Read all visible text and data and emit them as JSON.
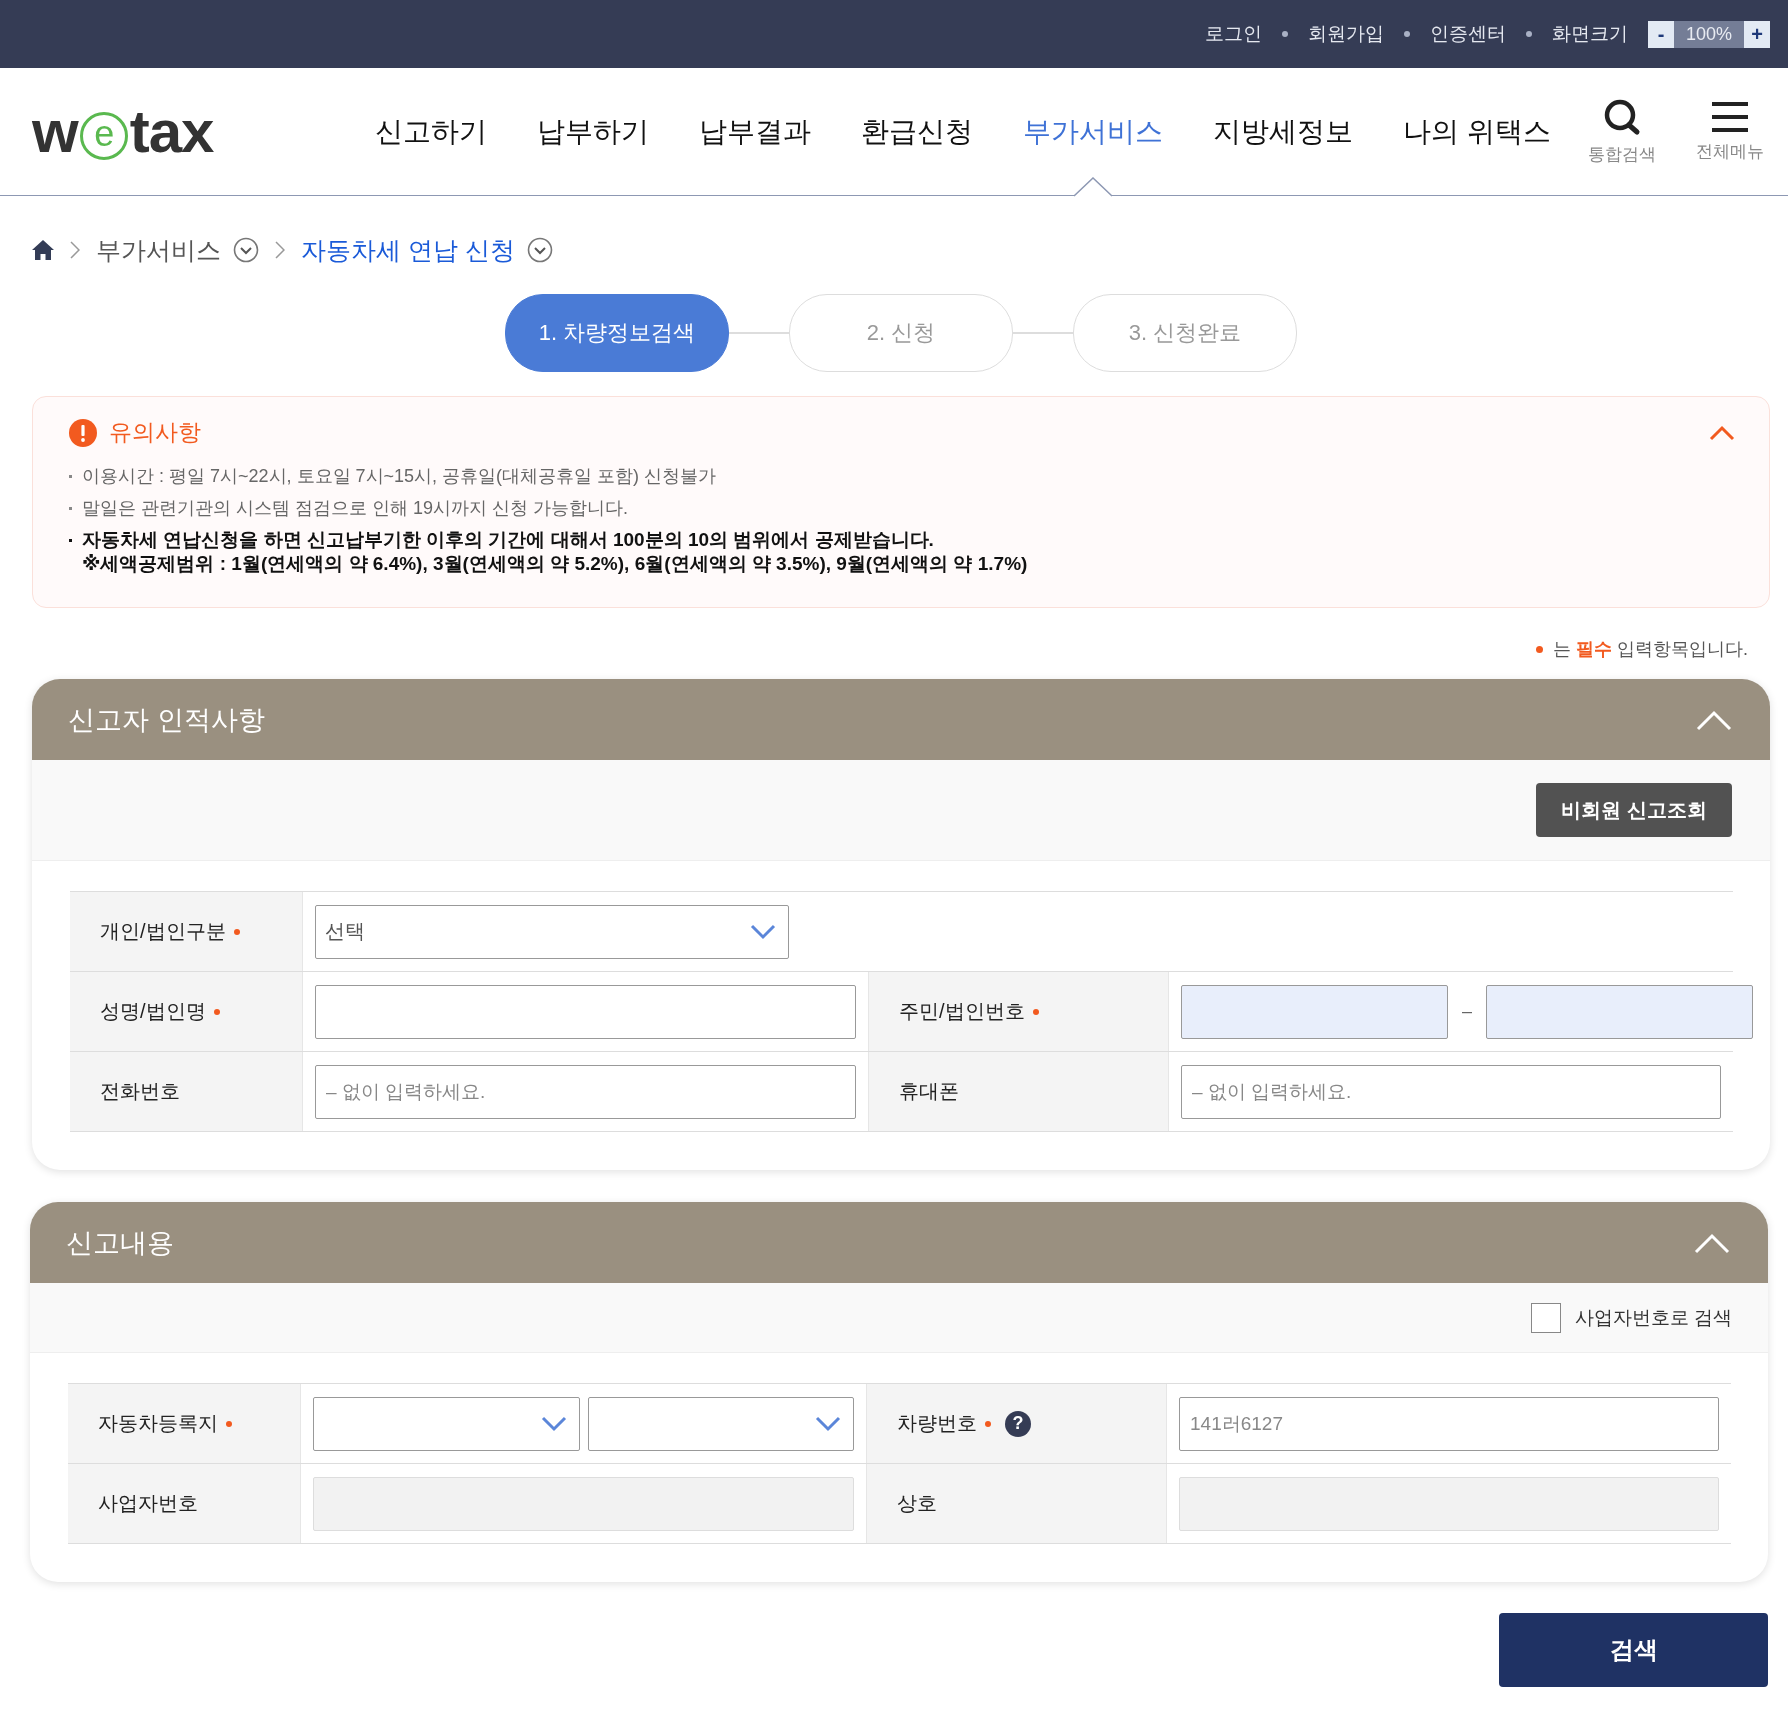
{
  "top_bar": {
    "links": [
      "로그인",
      "회원가입",
      "인증센터"
    ],
    "zoom": {
      "label": "화면크기",
      "minus": "-",
      "value": "100%",
      "plus": "+"
    }
  },
  "logo": {
    "before": "w",
    "mark": "e",
    "after": "tax"
  },
  "nav": [
    {
      "label": "신고하기",
      "selected": false
    },
    {
      "label": "납부하기",
      "selected": false
    },
    {
      "label": "납부결과",
      "selected": false
    },
    {
      "label": "환급신청",
      "selected": false
    },
    {
      "label": "부가서비스",
      "selected": true
    },
    {
      "label": "지방세정보",
      "selected": false
    },
    {
      "label": "나의 위택스",
      "selected": false
    }
  ],
  "tools": [
    {
      "kind": "search",
      "label": "통합검색"
    },
    {
      "kind": "menu",
      "label": "전체메뉴"
    }
  ],
  "breadcrumb": [
    {
      "label": "부가서비스",
      "current": false
    },
    {
      "label": "자동차세 연납 신청",
      "current": true
    }
  ],
  "steps": [
    {
      "label": "1. 차량정보검색",
      "selected": true
    },
    {
      "label": "2. 신청",
      "selected": false
    },
    {
      "label": "3. 신청완료",
      "selected": false
    }
  ],
  "notice": {
    "title": "유의사항",
    "expanded": true,
    "items": [
      {
        "lines": [
          "이용시간 : 평일 7시~22시, 토요일 7시~15시, 공휴일(대체공휴일 포함) 신청불가"
        ],
        "emphasized": false
      },
      {
        "lines": [
          "말일은 관련기관의 시스템 점검으로 인해 19시까지 신청 가능합니다."
        ],
        "emphasized": false
      },
      {
        "lines": [
          "자동차세 연납신청을 하면 신고납부기한 이후의 기간에 대해서 100분의 10의 범위에서 공제받습니다.",
          "※세액공제범위 : 1월(연세액의 약 6.4%), 3월(연세액의 약 5.2%), 6월(연세액의 약 3.5%), 9월(연세액의 약 1.7%)"
        ],
        "emphasized": true
      }
    ]
  },
  "required_note": "는 **필수** 입력항목입니다.",
  "sections": [
    {
      "title": "신고자 인적사항",
      "expanded": true,
      "toolbar": {
        "kind": "button",
        "label": "비회원 신고조회"
      },
      "rows": [
        [
          {
            "kind": "label",
            "text": "개인/법인구분",
            "required": true
          },
          {
            "kind": "select",
            "value": "선택"
          }
        ],
        [
          {
            "kind": "label",
            "text": "성명/법인명",
            "required": true
          },
          {
            "kind": "input"
          },
          {
            "kind": "label",
            "text": "주민/법인번호",
            "required": true
          },
          {
            "kind": "split",
            "separator": "–"
          }
        ],
        [
          {
            "kind": "label",
            "text": "전화번호",
            "required": false
          },
          {
            "kind": "input",
            "placeholder": "– 없이 입력하세요."
          },
          {
            "kind": "label",
            "text": "휴대폰",
            "required": false
          },
          {
            "kind": "input",
            "placeholder": "– 없이 입력하세요."
          }
        ]
      ]
    },
    {
      "title": "신고내용",
      "expanded": true,
      "toolbar": {
        "kind": "checkbox",
        "label": "사업자번호로 검색",
        "checked": false
      },
      "rows": [
        [
          {
            "kind": "label",
            "text": "자동차등록지",
            "required": true
          },
          {
            "kind": "select_pair"
          },
          {
            "kind": "label",
            "text": "차량번호",
            "required": true,
            "help": "?"
          },
          {
            "kind": "input",
            "placeholder": "141러6127"
          }
        ],
        [
          {
            "kind": "label",
            "text": "사업자번호",
            "required": false
          },
          {
            "kind": "disabled"
          },
          {
            "kind": "label",
            "text": "상호",
            "required": false
          },
          {
            "kind": "disabled"
          }
        ]
      ]
    }
  ],
  "search_button": "검색"
}
